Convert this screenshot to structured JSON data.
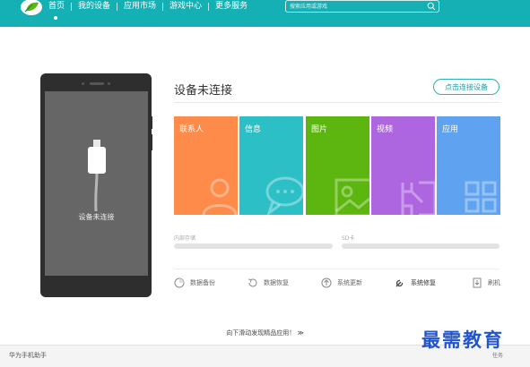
{
  "nav": {
    "items": [
      "首页",
      "我的设备",
      "应用市场",
      "游戏中心",
      "更多服务"
    ],
    "active_index": 0
  },
  "search": {
    "placeholder": "搜索应用或游戏"
  },
  "phone": {
    "status_text": "设备未连接"
  },
  "panel": {
    "title": "设备未连接",
    "connect_button": "点击连接设备"
  },
  "tiles": [
    {
      "label": "联系人",
      "color": "#ff8b4a",
      "icon": "contact-icon"
    },
    {
      "label": "信息",
      "color": "#2cbfc6",
      "icon": "message-icon"
    },
    {
      "label": "图片",
      "color": "#5cb60f",
      "icon": "picture-icon"
    },
    {
      "label": "视频",
      "color": "#ae66e0",
      "icon": "video-icon"
    },
    {
      "label": "应用",
      "color": "#5ea2f0",
      "icon": "apps-icon"
    }
  ],
  "storage": {
    "internal_label": "内部存储",
    "sd_label": "SD卡"
  },
  "tools": [
    {
      "label": "数据备份",
      "icon": "backup-icon"
    },
    {
      "label": "数据恢复",
      "icon": "restore-icon"
    },
    {
      "label": "系统更新",
      "icon": "update-icon"
    },
    {
      "label": "系统修复",
      "icon": "wrench-icon"
    },
    {
      "label": "刷机",
      "icon": "flash-icon"
    }
  ],
  "scroll_hint": "向下滑动发现精品应用！ ≫",
  "bottom": {
    "app_name": "华为手机助手",
    "task_label": "任务",
    "watermark": "最需教育"
  },
  "colors": {
    "topbar": "#15b0b4",
    "accent": "#1a9fa2"
  }
}
